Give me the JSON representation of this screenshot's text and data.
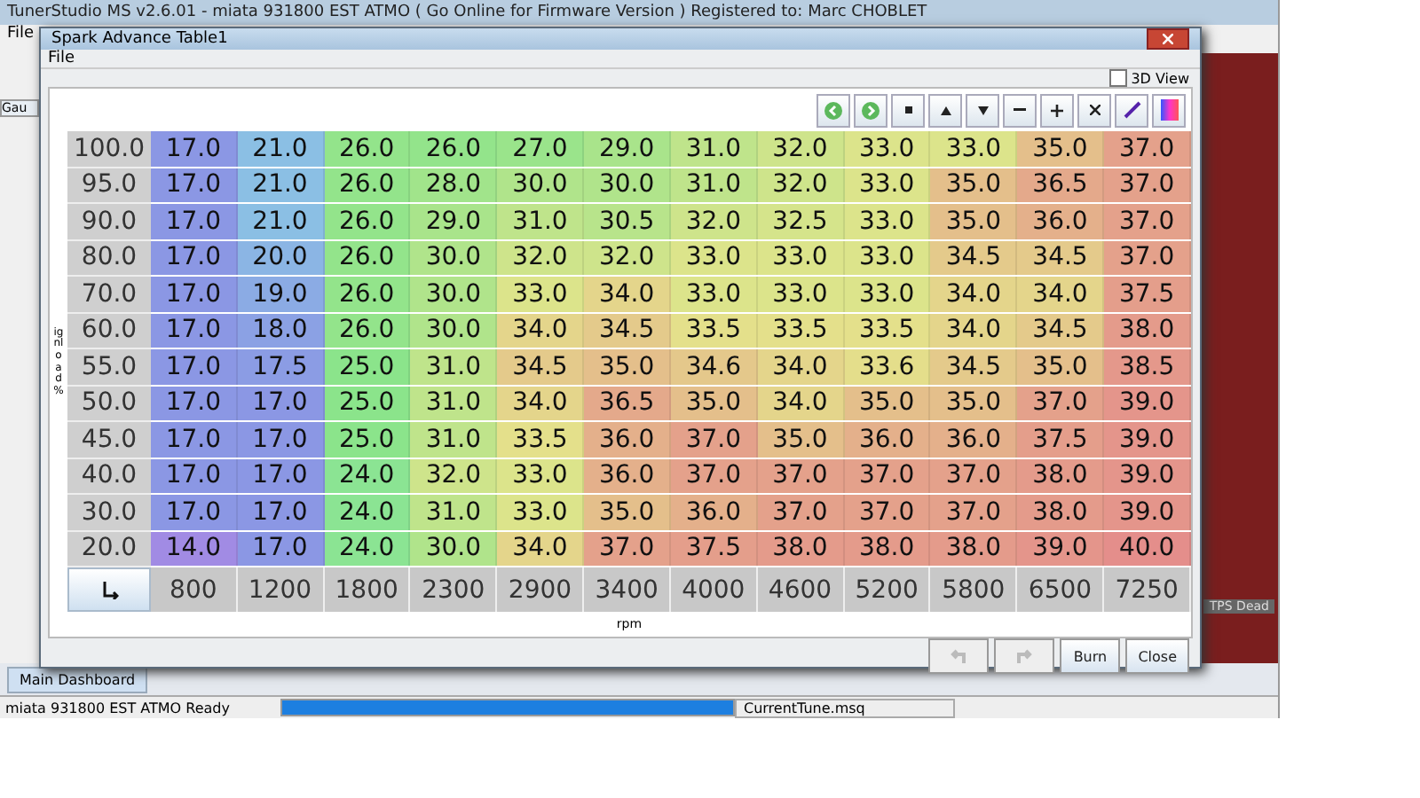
{
  "app": {
    "title": "TunerStudio MS v2.6.01 - miata 931800 EST ATMO ( Go Online for Firmware Version ) Registered to: Marc CHOBLET",
    "menu": [
      "File"
    ],
    "partial_tab": "Gau",
    "gauge_label": "TPS Dead"
  },
  "dialog": {
    "title": "Spark Advance Table1",
    "menu": [
      "File"
    ],
    "view_3d": {
      "label": "3D View",
      "checked": false
    },
    "toolbar": [
      {
        "kind": "back"
      },
      {
        "kind": "forward"
      },
      {
        "kind": "set"
      },
      {
        "kind": "up"
      },
      {
        "kind": "down"
      },
      {
        "kind": "minus"
      },
      {
        "kind": "plus"
      },
      {
        "kind": "scale"
      },
      {
        "kind": "pen"
      },
      {
        "kind": "colors"
      }
    ],
    "y_label": "ignload %",
    "x_label": "rpm",
    "rows": [
      {
        "load": "100.0",
        "values": [
          "17.0",
          "21.0",
          "26.0",
          "26.0",
          "27.0",
          "29.0",
          "31.0",
          "32.0",
          "33.0",
          "33.0",
          "35.0",
          "37.0"
        ]
      },
      {
        "load": "95.0",
        "values": [
          "17.0",
          "21.0",
          "26.0",
          "28.0",
          "30.0",
          "30.0",
          "31.0",
          "32.0",
          "33.0",
          "35.0",
          "36.5",
          "37.0"
        ]
      },
      {
        "load": "90.0",
        "values": [
          "17.0",
          "21.0",
          "26.0",
          "29.0",
          "31.0",
          "30.5",
          "32.0",
          "32.5",
          "33.0",
          "35.0",
          "36.0",
          "37.0"
        ]
      },
      {
        "load": "80.0",
        "values": [
          "17.0",
          "20.0",
          "26.0",
          "30.0",
          "32.0",
          "32.0",
          "33.0",
          "33.0",
          "33.0",
          "34.5",
          "34.5",
          "37.0"
        ]
      },
      {
        "load": "70.0",
        "values": [
          "17.0",
          "19.0",
          "26.0",
          "30.0",
          "33.0",
          "34.0",
          "33.0",
          "33.0",
          "33.0",
          "34.0",
          "34.0",
          "37.5"
        ]
      },
      {
        "load": "60.0",
        "values": [
          "17.0",
          "18.0",
          "26.0",
          "30.0",
          "34.0",
          "34.5",
          "33.5",
          "33.5",
          "33.5",
          "34.0",
          "34.5",
          "38.0"
        ]
      },
      {
        "load": "55.0",
        "values": [
          "17.0",
          "17.5",
          "25.0",
          "31.0",
          "34.5",
          "35.0",
          "34.6",
          "34.0",
          "33.6",
          "34.5",
          "35.0",
          "38.5"
        ]
      },
      {
        "load": "50.0",
        "values": [
          "17.0",
          "17.0",
          "25.0",
          "31.0",
          "34.0",
          "36.5",
          "35.0",
          "34.0",
          "35.0",
          "35.0",
          "37.0",
          "39.0"
        ]
      },
      {
        "load": "45.0",
        "values": [
          "17.0",
          "17.0",
          "25.0",
          "31.0",
          "33.5",
          "36.0",
          "37.0",
          "35.0",
          "36.0",
          "36.0",
          "37.5",
          "39.0"
        ]
      },
      {
        "load": "40.0",
        "values": [
          "17.0",
          "17.0",
          "24.0",
          "32.0",
          "33.0",
          "36.0",
          "37.0",
          "37.0",
          "37.0",
          "37.0",
          "38.0",
          "39.0"
        ]
      },
      {
        "load": "30.0",
        "values": [
          "17.0",
          "17.0",
          "24.0",
          "31.0",
          "33.0",
          "35.0",
          "36.0",
          "37.0",
          "37.0",
          "37.0",
          "38.0",
          "39.0"
        ]
      },
      {
        "load": "20.0",
        "values": [
          "14.0",
          "17.0",
          "24.0",
          "30.0",
          "34.0",
          "37.0",
          "37.5",
          "38.0",
          "38.0",
          "38.0",
          "39.0",
          "40.0"
        ]
      }
    ],
    "rpm": [
      "800",
      "1200",
      "1800",
      "2300",
      "2900",
      "3400",
      "4000",
      "4600",
      "5200",
      "5800",
      "6500",
      "7250"
    ],
    "buttons": [
      {
        "kind": "undo",
        "disabled": true
      },
      {
        "kind": "redo",
        "disabled": true
      },
      {
        "kind": "text",
        "label": "Burn",
        "disabled": false
      },
      {
        "kind": "text",
        "label": "Close",
        "disabled": false
      }
    ]
  },
  "tabs": [
    {
      "label": "Main Dashboard",
      "selected": true
    }
  ],
  "status": {
    "left": "miata 931800 EST ATMO Ready",
    "file": "CurrentTune.msq",
    "level": 1
  }
}
